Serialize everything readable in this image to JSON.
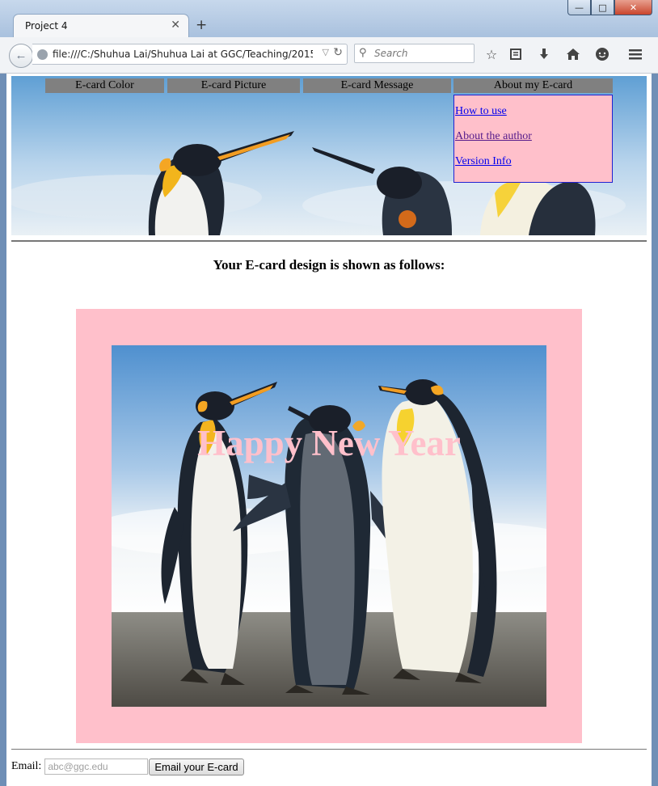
{
  "browser": {
    "tab_title": "Project 4",
    "url": "file:///C:/Shuhua Lai/Shuhua Lai at GGC/Teaching/2015_1_Sp",
    "search_placeholder": "Search",
    "window_controls": [
      "minimize-icon",
      "maximize-icon",
      "close-icon"
    ],
    "toolbar_icons": [
      "bookmark-star-icon",
      "reading-list-icon",
      "download-icon",
      "home-icon",
      "chat-icon",
      "hamburger-menu-icon"
    ]
  },
  "menu": {
    "items": [
      {
        "label": "E-card Color"
      },
      {
        "label": "E-card Picture"
      },
      {
        "label": "E-card Message"
      },
      {
        "label": "About my E-card"
      }
    ],
    "dropdown": [
      {
        "label": "How to use"
      },
      {
        "label": "About the author"
      },
      {
        "label": "Version Info"
      }
    ]
  },
  "page": {
    "heading": "Your E-card design is shown as follows:"
  },
  "ecard": {
    "background_color": "#ffc0cb",
    "message": "Happy New Year",
    "message_color": "#ffc0cb",
    "picture": "penguins"
  },
  "email": {
    "label": "Email:",
    "placeholder": "abc@ggc.edu",
    "button_label": "Email your E-card"
  }
}
